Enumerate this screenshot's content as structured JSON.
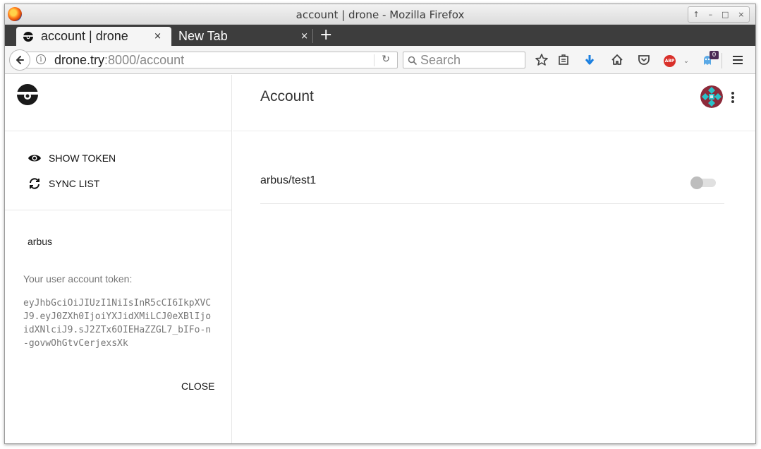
{
  "window": {
    "title": "account | drone - Mozilla Firefox",
    "controls": [
      "↑",
      "–",
      "□",
      "×"
    ]
  },
  "tabs": [
    {
      "label": "account | drone",
      "active": true,
      "close": "×"
    },
    {
      "label": "New Tab",
      "active": false,
      "close": "×"
    }
  ],
  "new_tab_label": "+",
  "navbar": {
    "url_host": "drone.try",
    "url_rest": ":8000/account",
    "search_placeholder": "Search",
    "extension_badge": "0",
    "abp_label": "ABP"
  },
  "sidebar": {
    "menu": [
      {
        "label": "SHOW TOKEN",
        "icon": "eye-icon"
      },
      {
        "label": "SYNC LIST",
        "icon": "sync-icon"
      }
    ],
    "username": "arbus",
    "token_label": "Your user account token:",
    "token": "eyJhbGciOiJIUzI1NiIsInR5cCI6IkpXVCJ9.eyJ0ZXh0IjoiYXJidXMiLCJ0eXBlIjoidXNlciJ9.sJ2ZTx6OIEHaZZGL7_bIFo-n-govwOhGtvCerjexsXk",
    "close_label": "CLOSE"
  },
  "main": {
    "title": "Account",
    "repos": [
      {
        "name": "arbus/test1",
        "enabled": false
      }
    ]
  },
  "colors": {
    "tabstrip": "#3d3d3d",
    "abp_red": "#d9302a",
    "download_blue": "#1a7fe0",
    "avatar_teal": "#29c2c9",
    "avatar_maroon": "#8c2a3a"
  }
}
